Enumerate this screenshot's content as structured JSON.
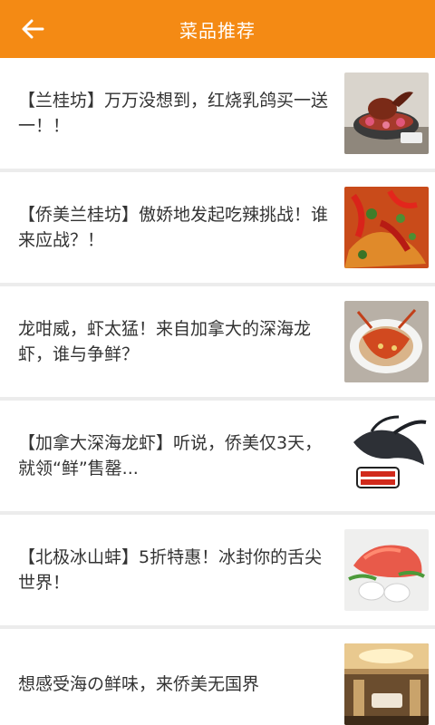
{
  "header": {
    "title": "菜品推荐",
    "back_icon": "arrow-left-icon",
    "background": "#f48a14"
  },
  "list": {
    "items": [
      {
        "title": "【兰桂坊】万万没想到，红烧乳鸽买一送一！！",
        "thumb_icon": "roast-pigeon-photo"
      },
      {
        "title": "【侨美兰桂坊】傲娇地发起吃辣挑战！谁来应战？！",
        "thumb_icon": "spicy-dish-photo"
      },
      {
        "title": "龙咁威，虾太猛！来自加拿大的深海龙虾，谁与争鲜？",
        "thumb_icon": "lobster-dish-photo"
      },
      {
        "title": "【加拿大深海龙虾】听说，侨美仅3天，就领“鲜”售罄...",
        "thumb_icon": "live-lobster-photo"
      },
      {
        "title": "【北极冰山蚌】5折特惠！冰封你的舌尖世界！",
        "thumb_icon": "clam-platter-photo"
      },
      {
        "title": "想感受海の鲜味，来侨美无国界",
        "thumb_icon": "restaurant-hall-photo"
      }
    ]
  }
}
